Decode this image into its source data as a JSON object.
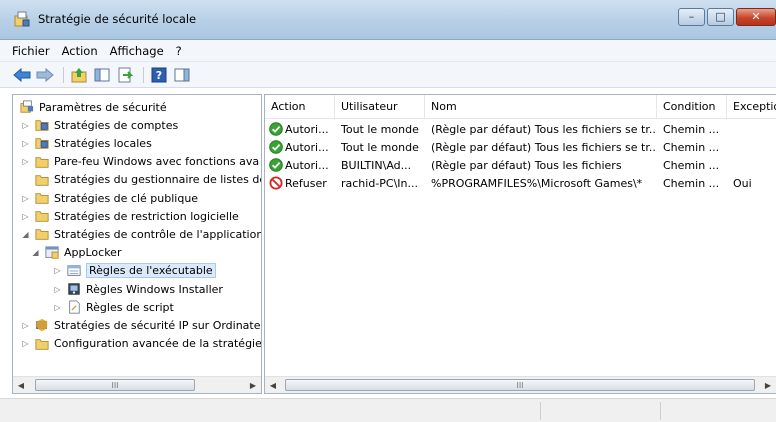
{
  "window": {
    "title": "Stratégie de sécurité locale",
    "controls": {
      "minimize": "–",
      "maximize": "□",
      "close": "✕"
    }
  },
  "menu": [
    "Fichier",
    "Action",
    "Affichage",
    "?"
  ],
  "toolbar": [
    "back-icon",
    "forward-icon",
    "up-folder-icon",
    "show-hide-tree-icon",
    "export-list-icon",
    "help-icon",
    "show-action-pane-icon"
  ],
  "tree": {
    "items": [
      {
        "label": "Paramètres de sécurité",
        "level": 0,
        "expander": "",
        "icon": "security-settings-icon"
      },
      {
        "label": "Stratégies de comptes",
        "level": 1,
        "expander": "▷",
        "icon": "policy-folder-icon"
      },
      {
        "label": "Stratégies locales",
        "level": 1,
        "expander": "▷",
        "icon": "policy-folder-icon"
      },
      {
        "label": "Pare-feu Windows avec fonctions ava",
        "level": 1,
        "expander": "▷",
        "icon": "folder-icon"
      },
      {
        "label": "Stratégies du gestionnaire de listes de",
        "level": 1,
        "expander": "",
        "icon": "folder-icon"
      },
      {
        "label": "Stratégies de clé publique",
        "level": 1,
        "expander": "▷",
        "icon": "folder-icon"
      },
      {
        "label": "Stratégies de restriction logicielle",
        "level": 1,
        "expander": "▷",
        "icon": "folder-icon"
      },
      {
        "label": "Stratégies de contrôle de l'application",
        "level": 1,
        "expander": "◢",
        "icon": "folder-icon"
      },
      {
        "label": "AppLocker",
        "level": 2,
        "expander": "◢",
        "icon": "applocker-icon"
      },
      {
        "label": "Règles de l'exécutable",
        "level": 3,
        "expander": "▷",
        "icon": "executable-rules-icon",
        "selected": true
      },
      {
        "label": "Règles Windows Installer",
        "level": 3,
        "expander": "▷",
        "icon": "installer-rules-icon"
      },
      {
        "label": "Règles de script",
        "level": 3,
        "expander": "▷",
        "icon": "script-rules-icon"
      },
      {
        "label": "Stratégies de sécurité IP sur Ordinateu",
        "level": 1,
        "expander": "▷",
        "icon": "ip-security-icon"
      },
      {
        "label": "Configuration avancée de la stratégie",
        "level": 1,
        "expander": "▷",
        "icon": "folder-icon"
      }
    ],
    "scroll_thumb": "III"
  },
  "list": {
    "columns": [
      "Action",
      "Utilisateur",
      "Nom",
      "Condition",
      "Exceptio"
    ],
    "rows": [
      {
        "status": "allow",
        "action": "Autori...",
        "user": "Tout le monde",
        "name": "(Règle par défaut) Tous les fichiers se tr...",
        "condition": "Chemin ...",
        "exception": ""
      },
      {
        "status": "allow",
        "action": "Autori...",
        "user": "Tout le monde",
        "name": "(Règle par défaut) Tous les fichiers se tr...",
        "condition": "Chemin ...",
        "exception": ""
      },
      {
        "status": "allow",
        "action": "Autori...",
        "user": "BUILTIN\\Ad...",
        "name": "(Règle par défaut) Tous les fichiers",
        "condition": "Chemin ...",
        "exception": ""
      },
      {
        "status": "deny",
        "action": "Refuser",
        "user": "rachid-PC\\In...",
        "name": "%PROGRAMFILES%\\Microsoft Games\\*",
        "condition": "Chemin ...",
        "exception": "Oui"
      }
    ],
    "scroll_thumb": "III"
  },
  "colors": {
    "allow": "#3aa335",
    "deny": "#d4261c",
    "folder": "#f2cf6a",
    "selection": "#dbeafb"
  }
}
